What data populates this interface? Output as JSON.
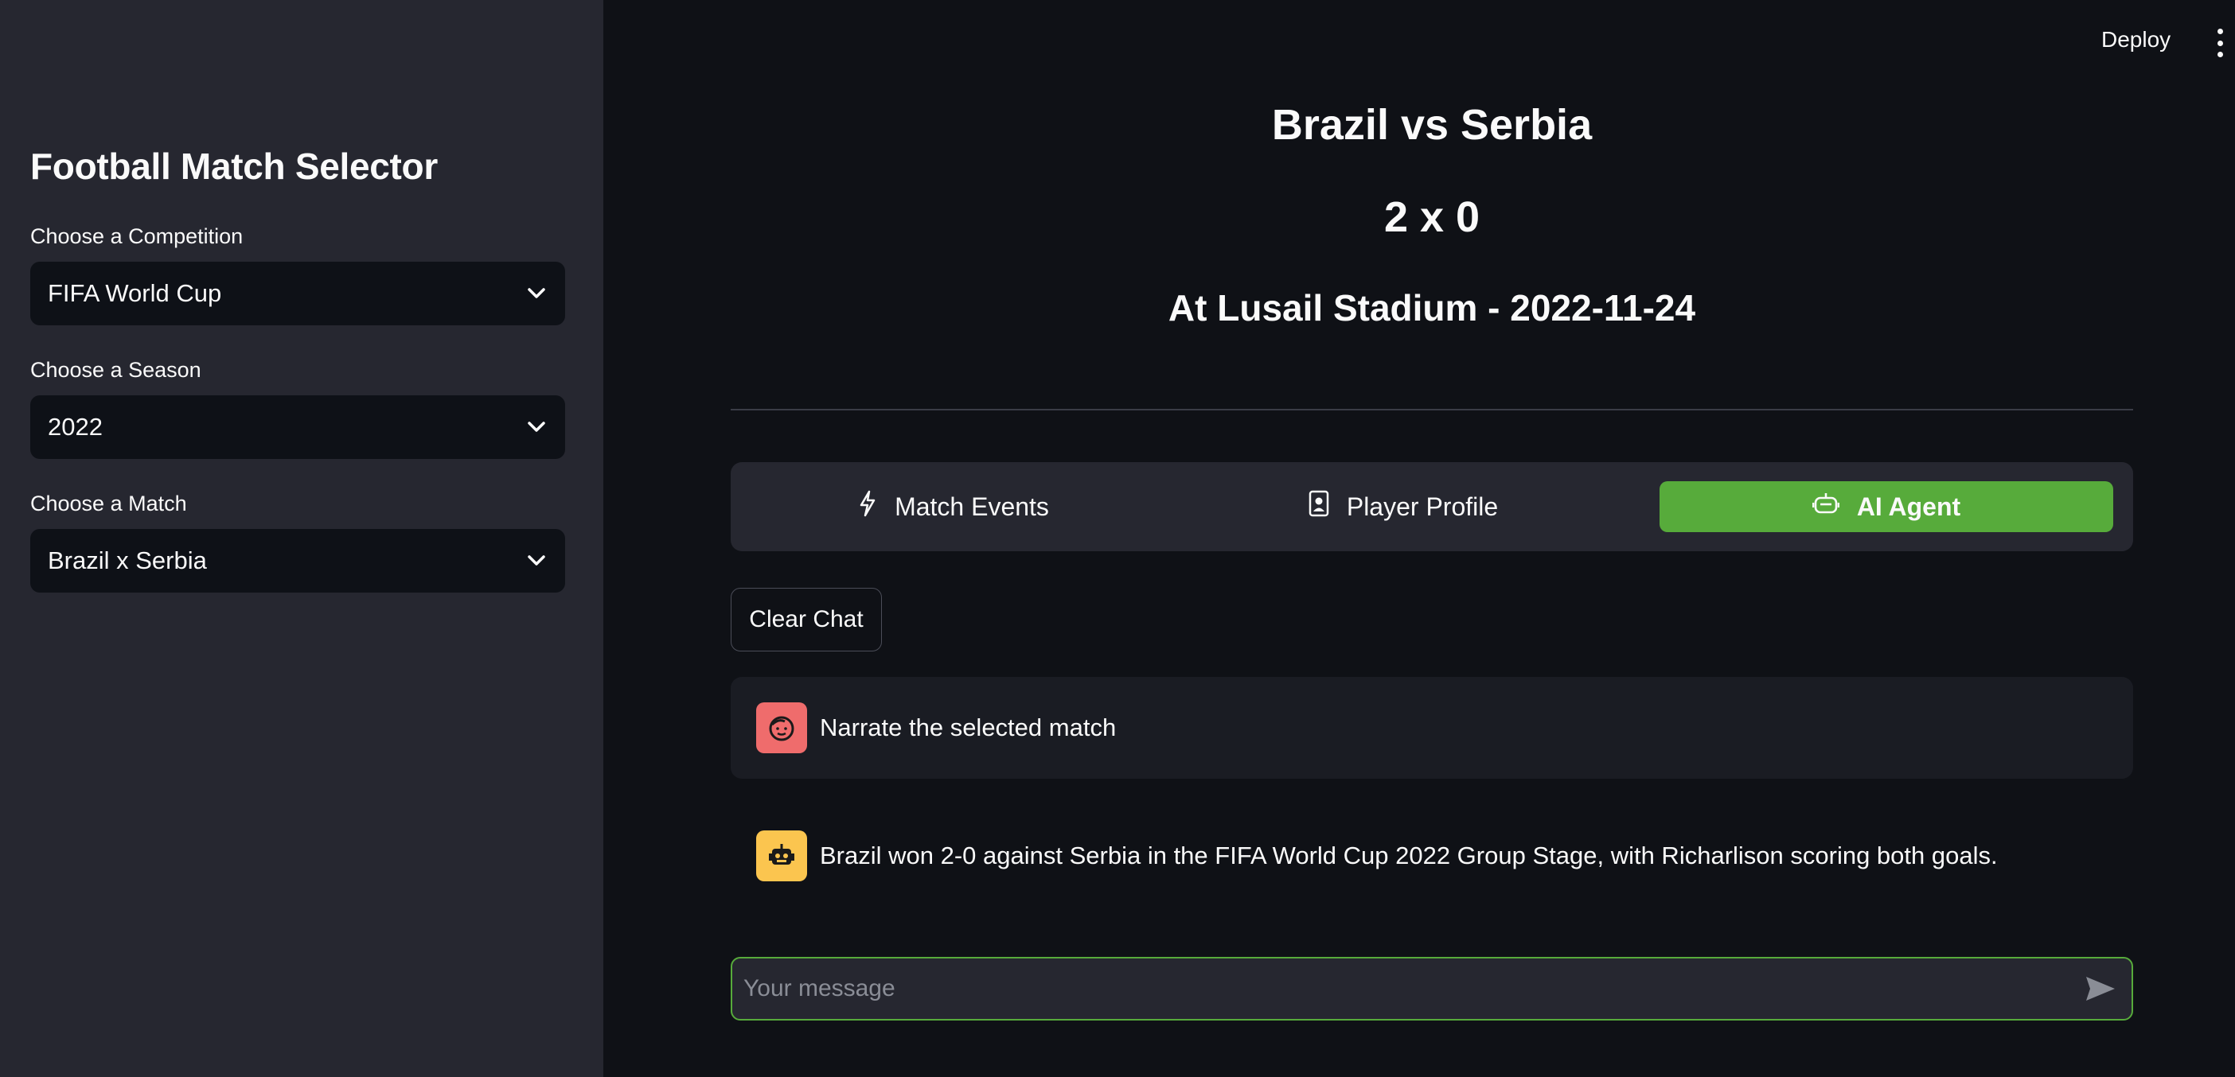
{
  "header": {
    "deploy_label": "Deploy",
    "menu_icon": "kebab-menu-icon"
  },
  "sidebar": {
    "title": "Football Match Selector",
    "fields": [
      {
        "label": "Choose a Competition",
        "value": "FIFA World Cup"
      },
      {
        "label": "Choose a Season",
        "value": "2022"
      },
      {
        "label": "Choose a Match",
        "value": "Brazil x Serbia"
      }
    ]
  },
  "match": {
    "title": "Brazil vs Serbia",
    "score": "2 x 0",
    "venue": "At Lusail Stadium - 2022-11-24"
  },
  "tabs": [
    {
      "label": "Match Events",
      "icon": "lightning-icon",
      "selected": false
    },
    {
      "label": "Player Profile",
      "icon": "profile-card-icon",
      "selected": false
    },
    {
      "label": "AI Agent",
      "icon": "robot-icon",
      "selected": true
    }
  ],
  "chat": {
    "clear_label": "Clear Chat",
    "messages": [
      {
        "role": "user",
        "text": "Narrate the selected match",
        "avatar_icon": "user-face-icon"
      },
      {
        "role": "assistant",
        "text": "Brazil won 2-0 against Serbia in the FIFA World Cup 2022 Group Stage, with Richarlison scoring both goals.",
        "avatar_icon": "robot-icon"
      }
    ],
    "input_placeholder": "Your message",
    "input_value": ""
  },
  "colors": {
    "accent_green": "#57ab3b",
    "user_avatar": "#ef6c6c",
    "assistant_avatar": "#fbc54f",
    "sidebar_bg": "#262730",
    "main_bg": "#0f1116"
  }
}
